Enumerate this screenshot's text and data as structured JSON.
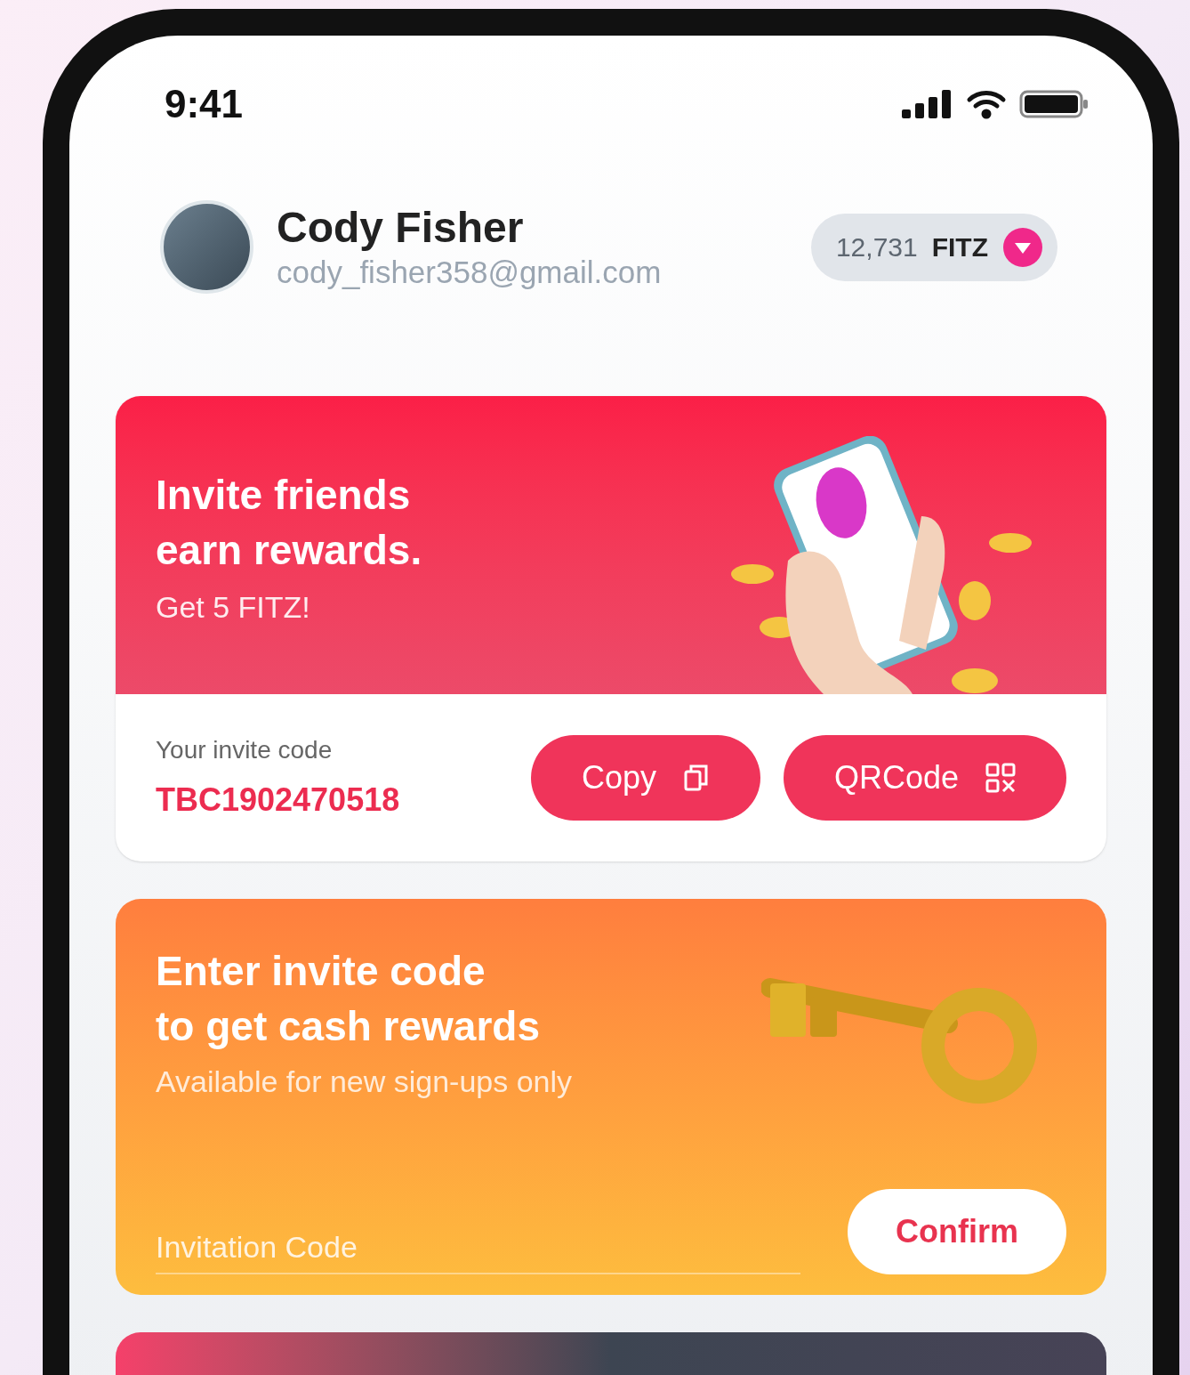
{
  "status_bar": {
    "time": "9:41"
  },
  "profile": {
    "name": "Cody Fisher",
    "email": "cody_fisher358@gmail.com"
  },
  "balance": {
    "amount": "12,731",
    "unit": "FITZ"
  },
  "invite_card": {
    "title_lines": [
      "Invite friends",
      "earn rewards."
    ],
    "subtitle": "Get 5 FITZ!",
    "code_label": "Your invite code",
    "code": "TBC1902470518",
    "buttons": [
      {
        "label": "Copy",
        "kind": "copy"
      },
      {
        "label": "QRCode",
        "kind": "qr"
      }
    ]
  },
  "enter_code_card": {
    "title_lines": [
      "Enter invite code",
      "to get cash rewards"
    ],
    "subtitle": "Available for new sign-ups only",
    "input": {
      "placeholder": "Invitation Code"
    },
    "button": "Confirm"
  }
}
